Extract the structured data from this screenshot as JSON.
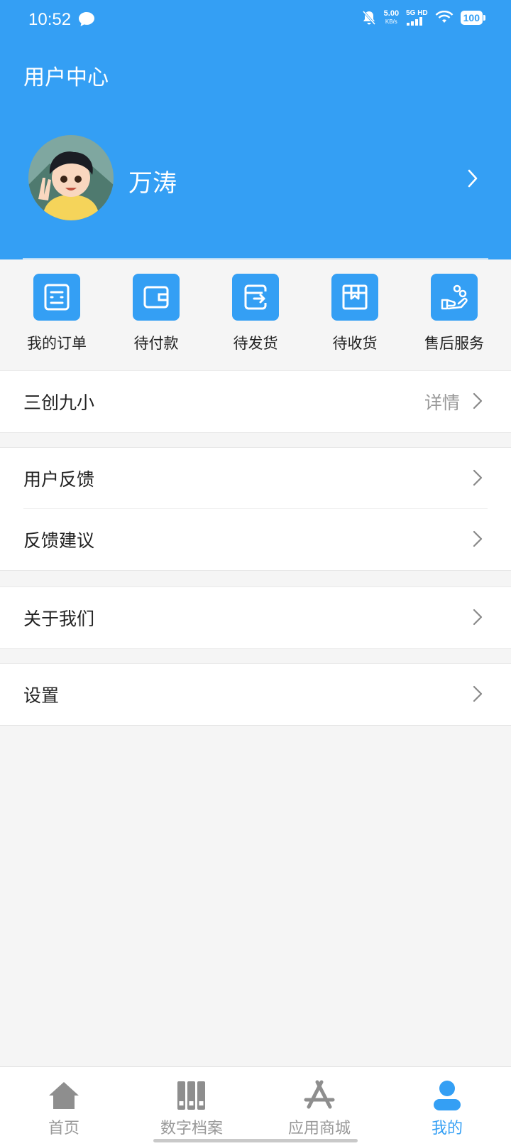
{
  "status_bar": {
    "time": "10:52",
    "net_speed": "5.00",
    "net_unit": "KB/s",
    "net_type": "5G HD",
    "battery": "100"
  },
  "header": {
    "title": "用户中心",
    "username": "万涛"
  },
  "orders": [
    {
      "label": "我的订单",
      "icon": "order-list-icon"
    },
    {
      "label": "待付款",
      "icon": "wallet-icon"
    },
    {
      "label": "待发货",
      "icon": "shipping-box-icon"
    },
    {
      "label": "待收货",
      "icon": "package-icon"
    },
    {
      "label": "售后服务",
      "icon": "service-hand-icon"
    }
  ],
  "menu": {
    "school": {
      "label": "三创九小",
      "extra": "详情"
    },
    "feedback_user": {
      "label": "用户反馈"
    },
    "feedback_suggest": {
      "label": "反馈建议"
    },
    "about": {
      "label": "关于我们"
    },
    "settings": {
      "label": "设置"
    }
  },
  "tabs": [
    {
      "label": "首页",
      "icon": "home-icon",
      "active": false
    },
    {
      "label": "数字档案",
      "icon": "archive-icon",
      "active": false
    },
    {
      "label": "应用商城",
      "icon": "app-store-icon",
      "active": false
    },
    {
      "label": "我的",
      "icon": "profile-icon",
      "active": true
    }
  ],
  "colors": {
    "primary": "#349ff4",
    "background": "#f5f5f5",
    "tab_inactive": "#999999"
  }
}
